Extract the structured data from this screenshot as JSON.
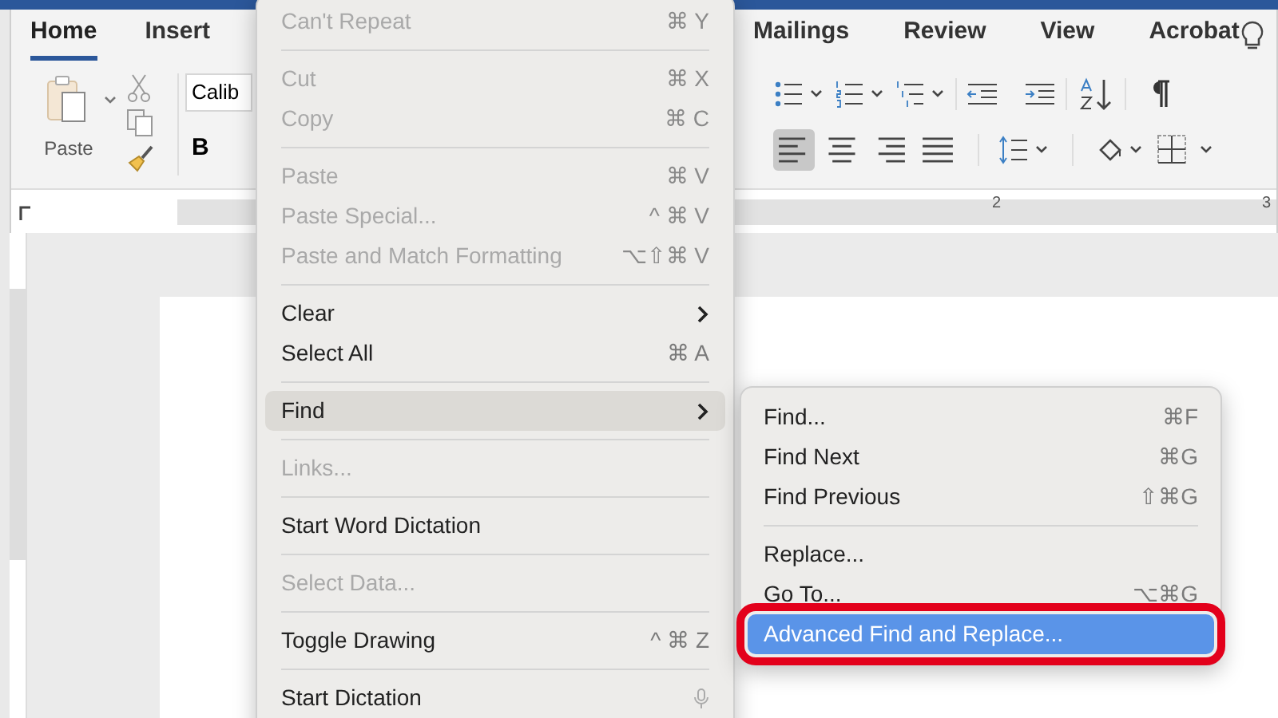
{
  "ribbon": {
    "tabs": [
      {
        "label": "Home",
        "selected": true
      },
      {
        "label": "Insert",
        "selected": false
      },
      {
        "label": "Mailings",
        "selected": false
      },
      {
        "label": "Review",
        "selected": false
      },
      {
        "label": "View",
        "selected": false
      },
      {
        "label": "Acrobat",
        "selected": false
      }
    ],
    "paste_label": "Paste",
    "font_field": "Calib",
    "bold_label": "B",
    "alignment": [
      {
        "selected": true
      },
      {
        "selected": false
      },
      {
        "selected": false
      },
      {
        "selected": false
      }
    ]
  },
  "ruler": {
    "labels": [
      "2",
      "3"
    ]
  },
  "edit_menu": [
    {
      "kind": "item",
      "label": "Can't Repeat",
      "shortcut": "⌘ Y",
      "disabled": true,
      "submenu": false,
      "selected": false
    },
    {
      "kind": "separator"
    },
    {
      "kind": "item",
      "label": "Cut",
      "shortcut": "⌘ X",
      "disabled": true,
      "submenu": false,
      "selected": false
    },
    {
      "kind": "item",
      "label": "Copy",
      "shortcut": "⌘ C",
      "disabled": true,
      "submenu": false,
      "selected": false
    },
    {
      "kind": "separator"
    },
    {
      "kind": "item",
      "label": "Paste",
      "shortcut": "⌘ V",
      "disabled": true,
      "submenu": false,
      "selected": false
    },
    {
      "kind": "item",
      "label": "Paste Special...",
      "shortcut": "^ ⌘ V",
      "disabled": true,
      "submenu": false,
      "selected": false
    },
    {
      "kind": "item",
      "label": "Paste and Match Formatting",
      "shortcut": "⌥⇧⌘ V",
      "disabled": true,
      "submenu": false,
      "selected": false
    },
    {
      "kind": "separator"
    },
    {
      "kind": "item",
      "label": "Clear",
      "disabled": false,
      "submenu": true,
      "selected": false
    },
    {
      "kind": "item",
      "label": "Select All",
      "shortcut": "⌘ A",
      "disabled": false,
      "submenu": false,
      "selected": false
    },
    {
      "kind": "separator"
    },
    {
      "kind": "item",
      "label": "Find",
      "disabled": false,
      "submenu": true,
      "selected": true
    },
    {
      "kind": "separator"
    },
    {
      "kind": "item",
      "label": "Links...",
      "disabled": true,
      "submenu": false,
      "selected": false
    },
    {
      "kind": "separator"
    },
    {
      "kind": "item",
      "label": "Start Word Dictation",
      "disabled": false,
      "submenu": false,
      "selected": false
    },
    {
      "kind": "separator"
    },
    {
      "kind": "item",
      "label": "Select Data...",
      "disabled": true,
      "submenu": false,
      "selected": false
    },
    {
      "kind": "separator"
    },
    {
      "kind": "item",
      "label": "Toggle Drawing",
      "shortcut": "^ ⌘ Z",
      "disabled": false,
      "submenu": false,
      "selected": false
    },
    {
      "kind": "separator"
    },
    {
      "kind": "item",
      "label": "Start Dictation",
      "microphone": true,
      "disabled": false,
      "submenu": false,
      "selected": false
    }
  ],
  "find_submenu": [
    {
      "kind": "item",
      "label": "Find...",
      "shortcut": "⌘F",
      "selected": false,
      "highlighted": false
    },
    {
      "kind": "item",
      "label": "Find Next",
      "shortcut": "⌘G",
      "selected": false,
      "highlighted": false
    },
    {
      "kind": "item",
      "label": "Find Previous",
      "shortcut": "⇧⌘G",
      "selected": false,
      "highlighted": false
    },
    {
      "kind": "separator"
    },
    {
      "kind": "item",
      "label": "Replace...",
      "selected": false,
      "highlighted": false
    },
    {
      "kind": "item",
      "label": "Go To...",
      "shortcut": "⌥⌘G",
      "selected": false,
      "highlighted": false
    },
    {
      "kind": "item",
      "label": "Advanced Find and Replace...",
      "selected": true,
      "highlighted": true
    }
  ]
}
